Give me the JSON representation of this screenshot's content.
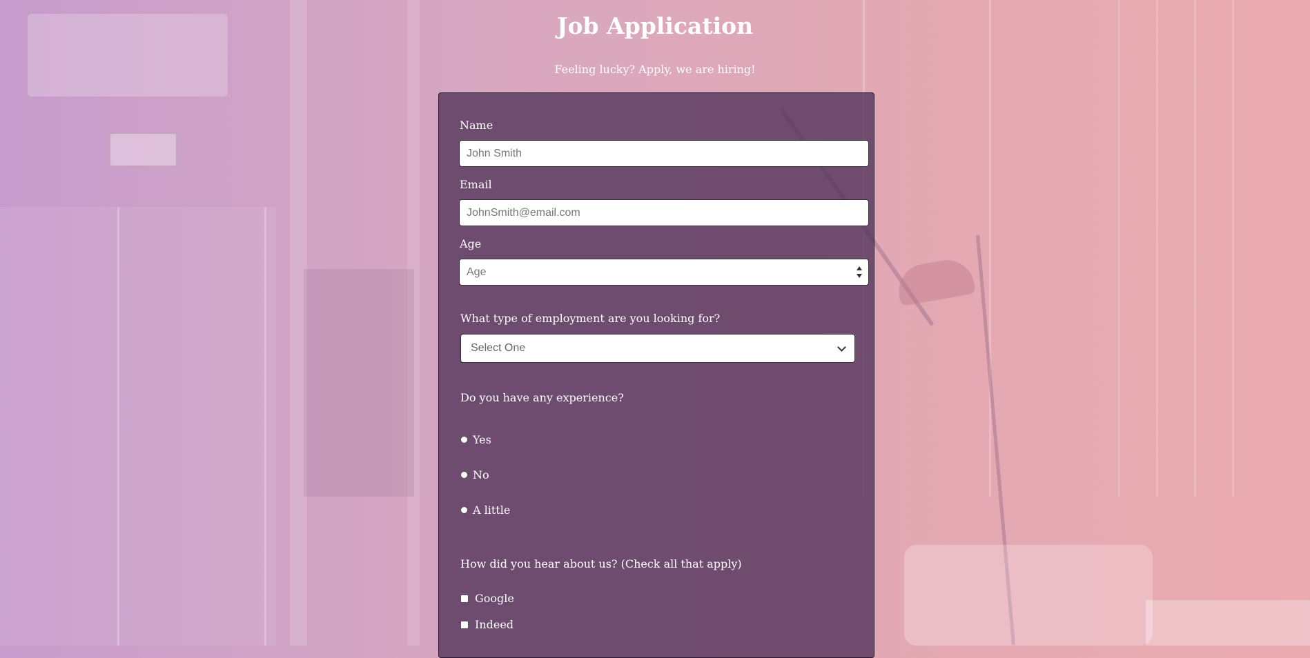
{
  "header": {
    "title": "Job Application",
    "subtitle": "Feeling lucky? Apply, we are hiring!"
  },
  "form": {
    "name": {
      "label": "Name",
      "placeholder": "John Smith"
    },
    "email": {
      "label": "Email",
      "placeholder": "JohnSmith@email.com"
    },
    "age": {
      "label": "Age",
      "placeholder": "Age"
    },
    "employment": {
      "question": "What type of employment are you looking for?",
      "selected": "Select One"
    },
    "experience": {
      "question": "Do you have any experience?",
      "options": [
        "Yes",
        "No",
        "A little"
      ]
    },
    "source": {
      "question": "How did you hear about us? (Check all that apply)",
      "options": [
        "Google",
        "Indeed"
      ]
    }
  },
  "colors": {
    "card_background": "#50325a",
    "text": "#ffffff",
    "page_gradient_left": "#c79ccc",
    "page_gradient_right": "#e9aab0"
  },
  "icons": {
    "select": "chevron-down-icon",
    "age_stepper": "spinner-icon"
  }
}
